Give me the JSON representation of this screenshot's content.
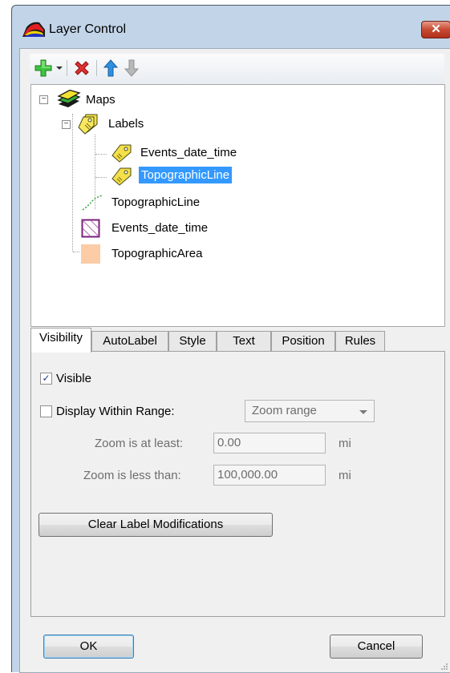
{
  "window": {
    "title": "Layer Control",
    "close_glyph": "✕"
  },
  "toolbar": {
    "icons": [
      "add-layer-icon",
      "dropdown-arrow-icon",
      "remove-layer-icon",
      "move-up-icon",
      "move-down-icon"
    ]
  },
  "tree": {
    "root_label": "Maps",
    "labels_group": "Labels",
    "label_children": [
      "Events_date_time",
      "TopographicLine"
    ],
    "layers": [
      "TopographicLine",
      "Events_date_time",
      "TopographicArea"
    ],
    "selected": "TopographicLine",
    "expander_minus": "−"
  },
  "tabs": [
    "Visibility",
    "AutoLabel",
    "Style",
    "Text",
    "Position",
    "Rules"
  ],
  "visibility": {
    "visible_label": "Visible",
    "visible_checked": true,
    "check_glyph": "✓",
    "range_label": "Display Within Range:",
    "range_checked": false,
    "zoom_combo": "Zoom range",
    "min_label": "Zoom is at least:",
    "min_value": "0.00",
    "max_label": "Zoom is less than:",
    "max_value": "100,000.00",
    "unit": "mi",
    "clear_button": "Clear Label Modifications"
  },
  "footer": {
    "ok": "OK",
    "cancel": "Cancel"
  },
  "colors": {
    "selection": "#3399ff",
    "area_fill": "#fbcca5",
    "events_border": "#7a1f7a"
  }
}
